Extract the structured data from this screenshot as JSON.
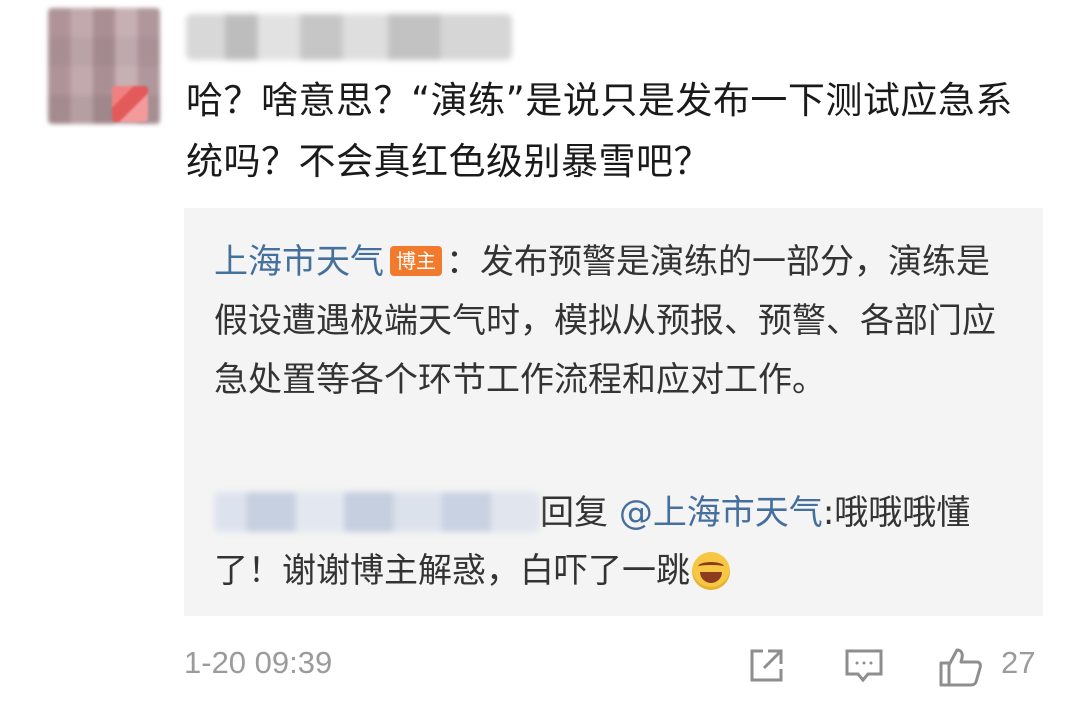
{
  "comment": {
    "text": "哈？啥意思？“演练”是说只是发布一下测试应急系统吗？不会真红色级别暴雪吧？"
  },
  "reply_1": {
    "author": "上海市天气",
    "badge": "博主",
    "text": "：发布预警是演练的一部分，演练是假设遭遇极端天气时，模拟从预报、预警、各部门应急处置等各个环节工作流程和应对工作。"
  },
  "reply_2": {
    "reply_word": "回复",
    "mention": "@上海市天气",
    "text": ":哦哦哦懂了！谢谢博主解惑，白吓了一跳"
  },
  "footer": {
    "time": "1-20 09:39",
    "like_count": "27"
  },
  "icons": [
    "share-icon",
    "comment-icon",
    "like-icon",
    "laughing-emoji-icon"
  ],
  "colors": {
    "link": "#45709e",
    "badge": "#f27a2c",
    "reply_bg": "#f4f4f4",
    "meta": "#9b9b9b"
  }
}
